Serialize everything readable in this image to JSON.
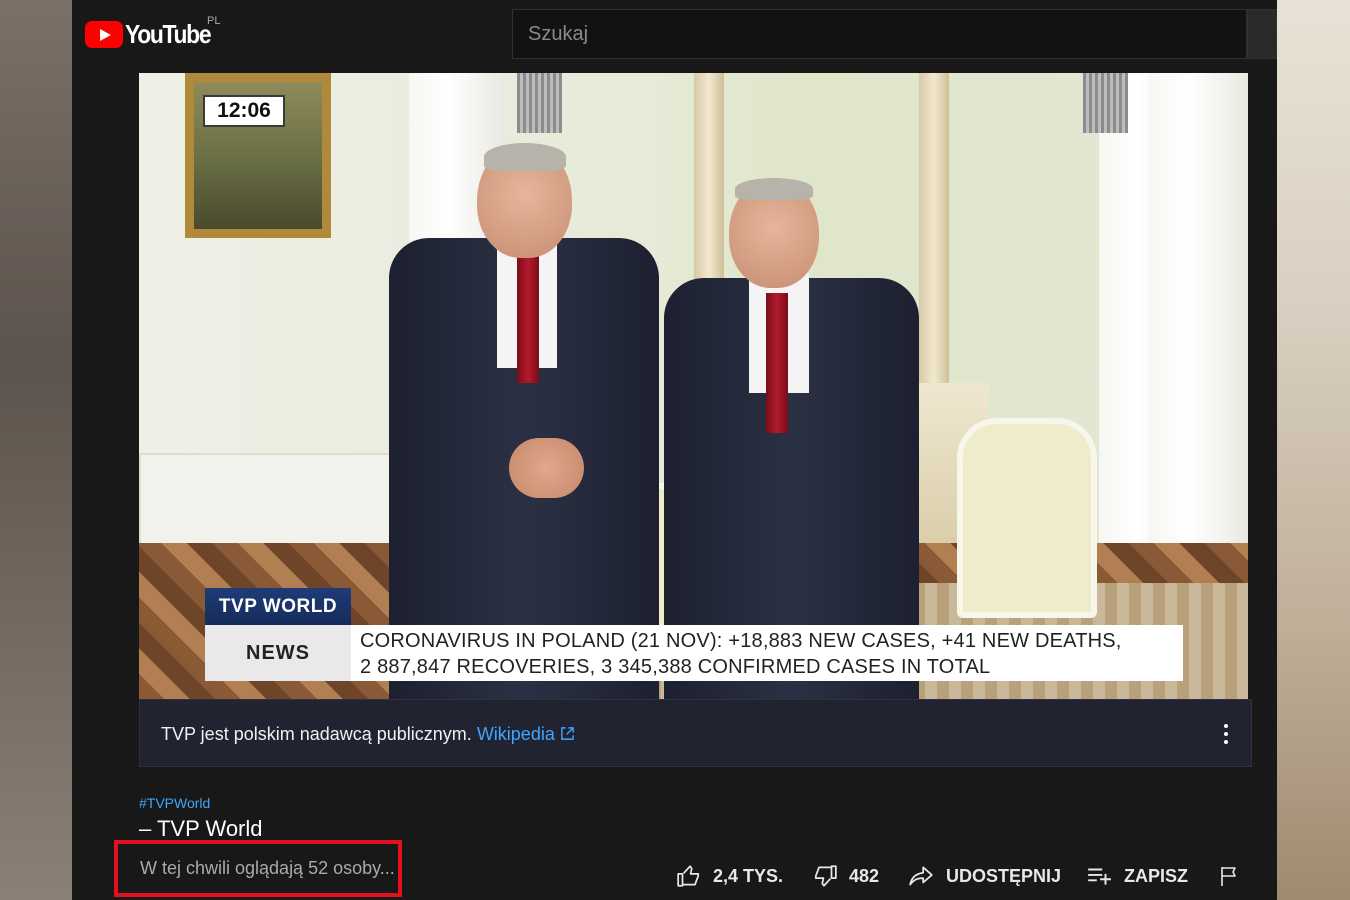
{
  "header": {
    "logo_text": "YouTube",
    "region": "PL",
    "search_placeholder": "Szukaj"
  },
  "video": {
    "clock": "12:06",
    "channel_badge": "TVP WORLD",
    "news_label": "NEWS",
    "ticker_line1": "CORONAVIRUS IN POLAND (21 NOV): +18,883 NEW CASES, +41 NEW DEATHS,",
    "ticker_line2": "2 887,847 RECOVERIES, 3 345,388 CONFIRMED CASES IN TOTAL"
  },
  "info_panel": {
    "text": "TVP jest polskim nadawcą publicznym.",
    "link": "Wikipedia"
  },
  "meta": {
    "hashtag": "#TVPWorld",
    "title": "– TVP World",
    "viewers": "W tej chwili oglądają 52 osoby..."
  },
  "actions": {
    "like_count": "2,4 TYS.",
    "dislike_count": "482",
    "share_label": "UDOSTĘPNIJ",
    "save_label": "ZAPISZ"
  },
  "colors": {
    "background": "#181818",
    "link": "#3ea6ff",
    "highlight_box": "#e3101f",
    "logo_red": "#ff0000"
  }
}
